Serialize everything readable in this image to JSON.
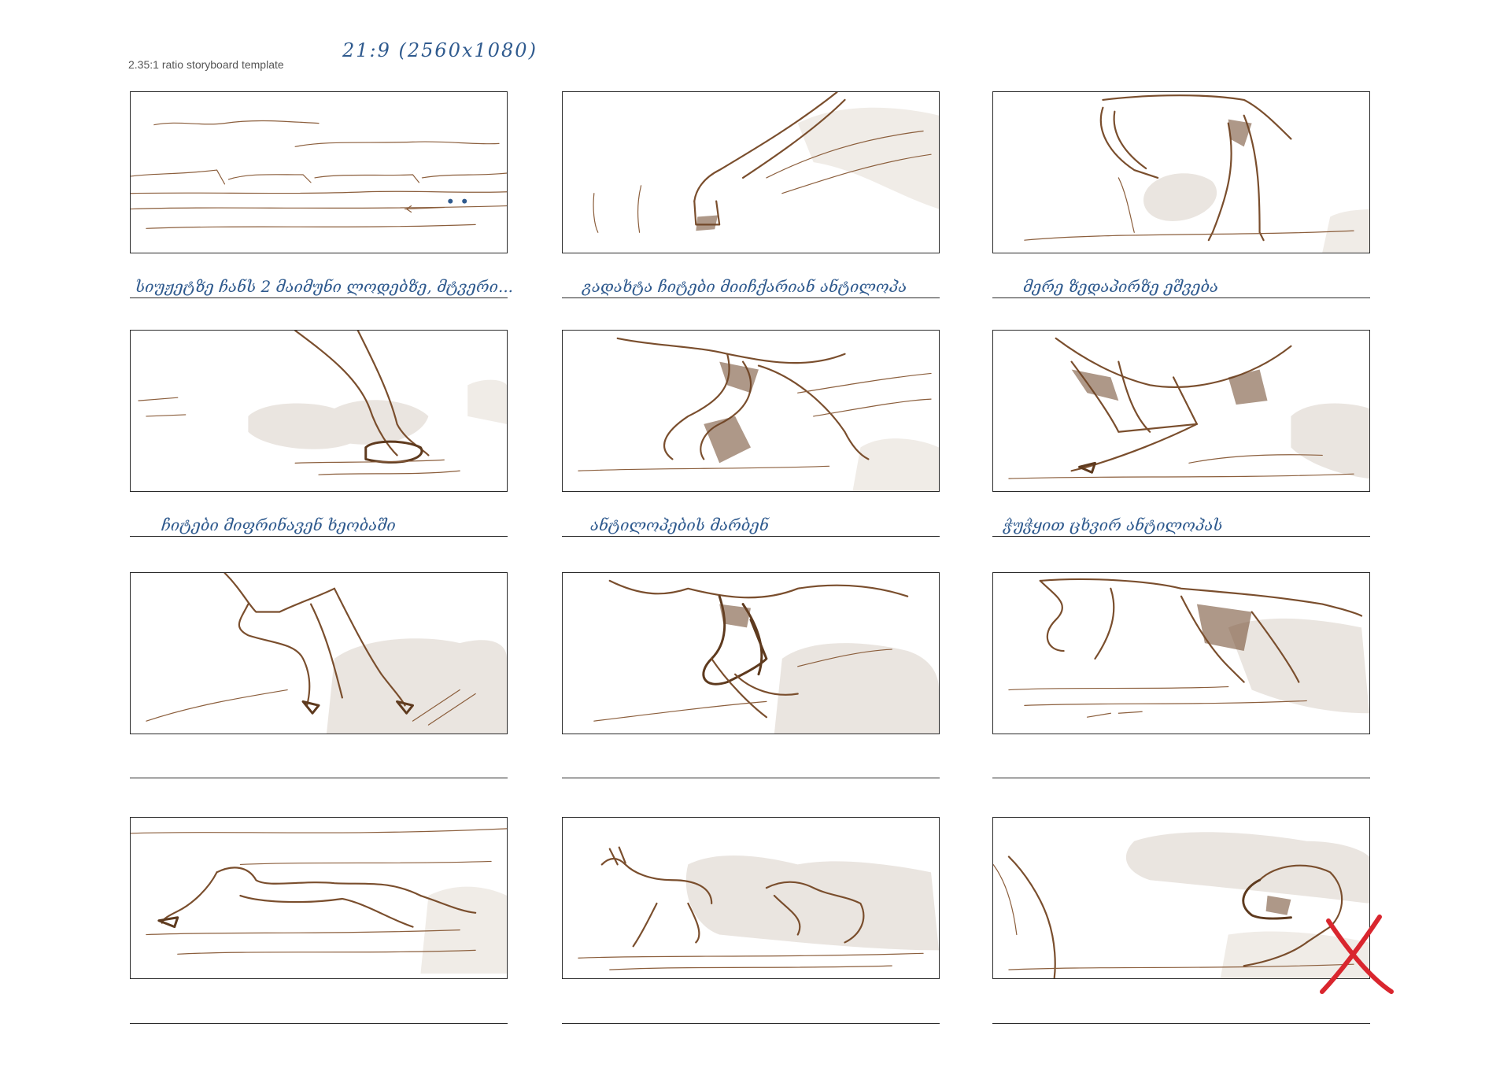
{
  "page": {
    "heading": "2.35:1 ratio storyboard template",
    "ratio_note": "21:9  (2560x1080)"
  },
  "storyboard": {
    "columns": 3,
    "rows": 4,
    "panels": [
      {
        "scene": "landscape-horizon",
        "caption": "სიუჟეტზე  ჩანს  2  მაიმუნი  ლოდებზე,  მტვერი..."
      },
      {
        "scene": "antelope-leg-leap",
        "caption": "გადახტა  ჩიტები  მიიჩქარიან  ანტილოპა"
      },
      {
        "scene": "antelope-hind-legs-dust",
        "caption": "მერე  ზედაპირზე  ეშვება"
      },
      {
        "scene": "paw-on-ground",
        "caption": "ჩიტები  მიფრინავენ  ხეობაში"
      },
      {
        "scene": "legs-running",
        "caption": "ანტილოპების  მარბენ"
      },
      {
        "scene": "antelope-leaping-overhead",
        "caption": "ჭუჭყით  ცხვირ  ანტილოპას"
      },
      {
        "scene": "cheetah-legs-running",
        "caption": ""
      },
      {
        "scene": "cheetah-pounce-dust",
        "caption": ""
      },
      {
        "scene": "cheetah-running-side",
        "caption": ""
      },
      {
        "scene": "cheetah-stretched-sprint",
        "caption": ""
      },
      {
        "scene": "antelope-chased-by-cheetah",
        "caption": ""
      },
      {
        "scene": "cheetah-roar-closeup",
        "caption": "",
        "rejected": true
      }
    ]
  },
  "colors": {
    "sketch": "#7a4e2d",
    "handwriting": "#2f5a8e",
    "reject_mark": "#d9262e"
  }
}
